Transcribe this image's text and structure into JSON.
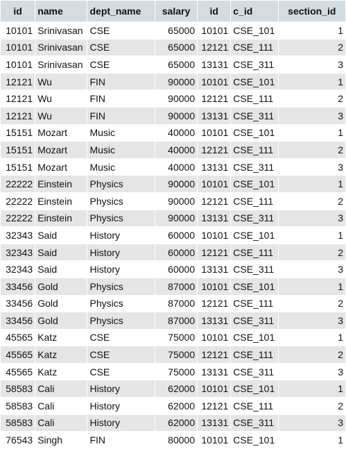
{
  "table": {
    "columns": [
      "id",
      "name",
      "dept_name",
      "salary",
      "id",
      "c_id",
      "section_id"
    ],
    "rows": [
      [
        "10101",
        "Srinivasan",
        "CSE",
        "65000",
        "10101",
        "CSE_101",
        "1"
      ],
      [
        "10101",
        "Srinivasan",
        "CSE",
        "65000",
        "12121",
        "CSE_111",
        "2"
      ],
      [
        "10101",
        "Srinivasan",
        "CSE",
        "65000",
        "13131",
        "CSE_311",
        "3"
      ],
      [
        "12121",
        "Wu",
        "FIN",
        "90000",
        "10101",
        "CSE_101",
        "1"
      ],
      [
        "12121",
        "Wu",
        "FIN",
        "90000",
        "12121",
        "CSE_111",
        "2"
      ],
      [
        "12121",
        "Wu",
        "FIN",
        "90000",
        "13131",
        "CSE_311",
        "3"
      ],
      [
        "15151",
        "Mozart",
        "Music",
        "40000",
        "10101",
        "CSE_101",
        "1"
      ],
      [
        "15151",
        "Mozart",
        "Music",
        "40000",
        "12121",
        "CSE_111",
        "2"
      ],
      [
        "15151",
        "Mozart",
        "Music",
        "40000",
        "13131",
        "CSE_311",
        "3"
      ],
      [
        "22222",
        "Einstein",
        "Physics",
        "90000",
        "10101",
        "CSE_101",
        "1"
      ],
      [
        "22222",
        "Einstein",
        "Physics",
        "90000",
        "12121",
        "CSE_111",
        "2"
      ],
      [
        "22222",
        "Einstein",
        "Physics",
        "90000",
        "13131",
        "CSE_311",
        "3"
      ],
      [
        "32343",
        "Said",
        "History",
        "60000",
        "10101",
        "CSE_101",
        "1"
      ],
      [
        "32343",
        "Said",
        "History",
        "60000",
        "12121",
        "CSE_111",
        "2"
      ],
      [
        "32343",
        "Said",
        "History",
        "60000",
        "13131",
        "CSE_311",
        "3"
      ],
      [
        "33456",
        "Gold",
        "Physics",
        "87000",
        "10101",
        "CSE_101",
        "1"
      ],
      [
        "33456",
        "Gold",
        "Physics",
        "87000",
        "12121",
        "CSE_111",
        "2"
      ],
      [
        "33456",
        "Gold",
        "Physics",
        "87000",
        "13131",
        "CSE_311",
        "3"
      ],
      [
        "45565",
        "Katz",
        "CSE",
        "75000",
        "10101",
        "CSE_101",
        "1"
      ],
      [
        "45565",
        "Katz",
        "CSE",
        "75000",
        "12121",
        "CSE_111",
        "2"
      ],
      [
        "45565",
        "Katz",
        "CSE",
        "75000",
        "13131",
        "CSE_311",
        "3"
      ],
      [
        "58583",
        "Cali",
        "History",
        "62000",
        "10101",
        "CSE_101",
        "1"
      ],
      [
        "58583",
        "Cali",
        "History",
        "62000",
        "12121",
        "CSE_111",
        "2"
      ],
      [
        "58583",
        "Cali",
        "History",
        "62000",
        "13131",
        "CSE_311",
        "3"
      ],
      [
        "76543",
        "Singh",
        "FIN",
        "80000",
        "10101",
        "CSE_101",
        "1"
      ]
    ]
  },
  "colors": {
    "header_bg": "#d3dce3",
    "row_odd_bg": "#ffffff",
    "row_even_bg": "#e5e5e5"
  }
}
